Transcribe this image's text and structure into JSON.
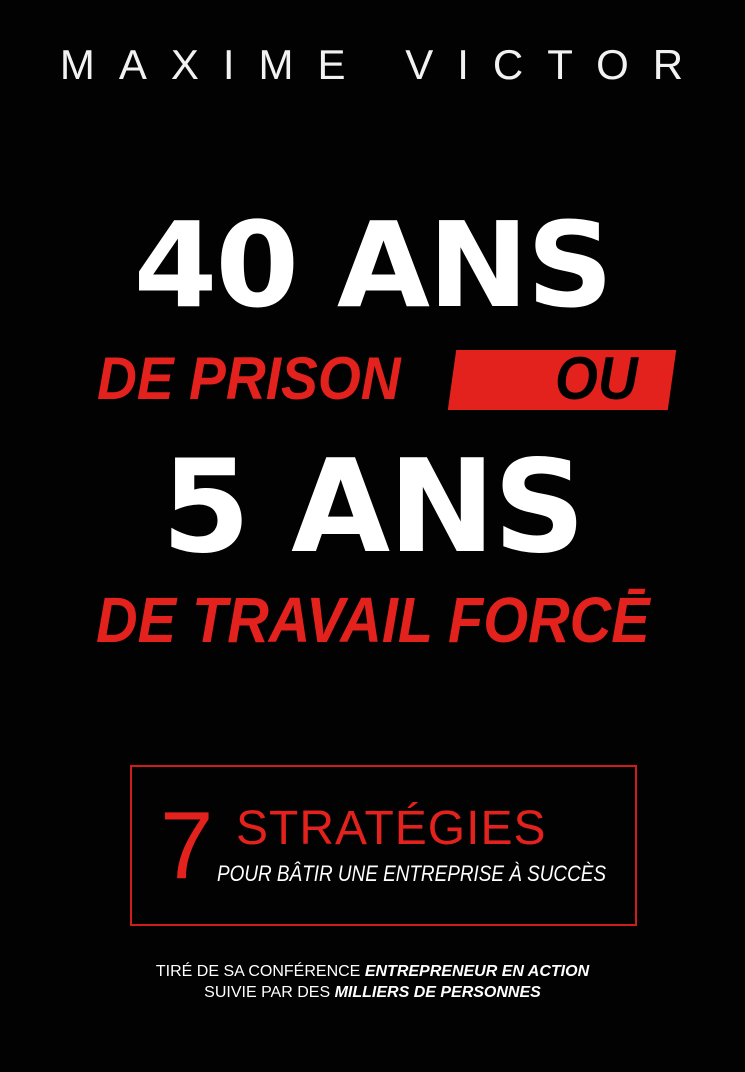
{
  "cover": {
    "author": "MAXIME VICTOR",
    "headline_1": "40 ANS",
    "subhead_1": "DE PRISON",
    "connector": "OU",
    "headline_2": "5 ANS",
    "subhead_2": "DE TRAVAIL FORCĒ",
    "strategy_box": {
      "number": "7",
      "title": "STRATÉGIES",
      "subtitle": "POUR BÂTIR UNE ENTREPRISE À SUCCÈS"
    },
    "footer": {
      "line1_plain": "TIRÉ DE SA CONFÉRENCE",
      "line1_emphasis": "ENTREPRENEUR EN ACTION",
      "line2_plain": "SUIVIE PAR DES",
      "line2_emphasis": "MILLIERS DE PERSONNES"
    },
    "colors": {
      "background": "#020202",
      "accent_red": "#e3211d",
      "text": "#ffffff"
    }
  }
}
